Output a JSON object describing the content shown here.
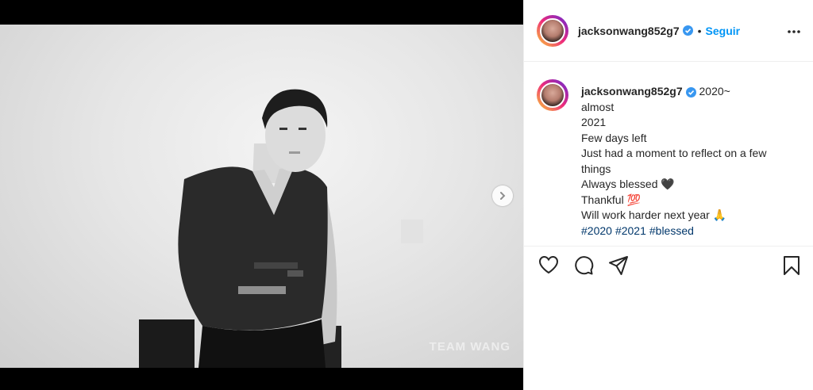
{
  "post": {
    "watermark": "TEAM WANG",
    "carousel": {
      "slides": 2,
      "active": 0
    }
  },
  "header": {
    "username": "jacksonwang852g7",
    "separator": "•",
    "follow_label": "Seguir"
  },
  "caption": {
    "username": "jacksonwang852g7",
    "lines": [
      "2020~",
      "almost",
      "2021",
      "Few days left",
      "Just had a moment to reflect on a few",
      "things",
      "Always blessed 🖤",
      "Thankful 💯",
      "Will work harder next year 🙏"
    ],
    "hashtags": [
      "#2020",
      "#2021",
      "#blessed"
    ]
  },
  "colors": {
    "link_blue": "#0095f6",
    "hashtag": "#00376b",
    "verified": "#3897f0"
  }
}
